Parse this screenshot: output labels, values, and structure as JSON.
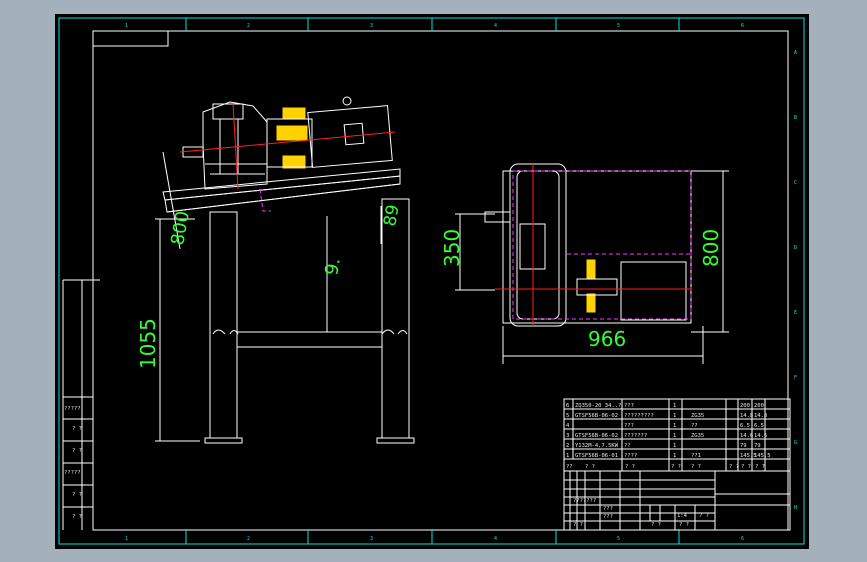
{
  "drawing": {
    "zone_columns": [
      "1",
      "2",
      "3",
      "4",
      "5",
      "6"
    ],
    "zone_rows": [
      "A",
      "B",
      "C",
      "D",
      "E",
      "F",
      "G",
      "H"
    ],
    "dimensions": {
      "side_height_800": "800",
      "side_height_1055": "1055",
      "side_height_89": "89",
      "side_center_label": "9.",
      "top_350": "350",
      "top_800": "800",
      "top_966": "966"
    },
    "left_labels": [
      "?????",
      "? ?",
      "? ?",
      "?????",
      "? ?",
      "? ?"
    ],
    "bom_rows": [
      {
        "no": "6",
        "code": "ZQ350-20 34..?",
        "name": "???",
        "qty": "1",
        "mat": "",
        "w1": "200",
        "w2": "200"
      },
      {
        "no": "5",
        "code": "GTSF56B-06-02",
        "name": "?????????",
        "qty": "1",
        "mat": "ZG35",
        "w1": "14.8",
        "w2": "14.8"
      },
      {
        "no": "4",
        "code": "",
        "name": "???",
        "qty": "1",
        "mat": "??",
        "w1": "6.5",
        "w2": "6.5"
      },
      {
        "no": "3",
        "code": "GTSF56B-06-02",
        "name": "???????",
        "qty": "1",
        "mat": "ZG35",
        "w1": "14.6",
        "w2": "14.6"
      },
      {
        "no": "2",
        "code": "Y132M-4,7.5KW",
        "name": "??",
        "qty": "1",
        "mat": "",
        "w1": "79",
        "w2": "79"
      },
      {
        "no": "1",
        "code": "GTSF56B-06-01",
        "name": "????",
        "qty": "1",
        "mat": "??1",
        "w1": "145.5",
        "w2": "145.5"
      }
    ],
    "bom_header": [
      "??",
      "? ?",
      "? ?",
      "? ?",
      "? ?",
      "? ?",
      "? ?",
      "? ?"
    ],
    "title_block": {
      "row1": "???????",
      "row2": "???",
      "row3": "???",
      "row4": "? ?",
      "scale": "1:4",
      "cells": [
        "? ?",
        "? ?",
        "? ?"
      ]
    }
  }
}
